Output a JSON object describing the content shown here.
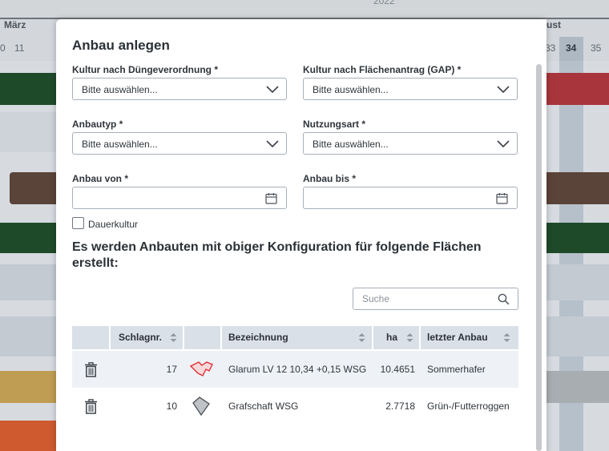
{
  "background": {
    "year_label": "2022",
    "month_left": "März",
    "month_right": "ust",
    "weeks_left": [
      "0",
      "11"
    ],
    "weeks_right": [
      "33",
      "34",
      "35"
    ],
    "highlighted_week": "34",
    "colors": {
      "dark_green": "#1f4a2a",
      "brown": "#5a4338",
      "red": "#a8353b",
      "gold": "#bf9d52",
      "orange": "#cf5a30",
      "grey": "#a8adb2",
      "highlight": "#b6c0cb"
    }
  },
  "modal": {
    "title": "Anbau anlegen",
    "fields": {
      "kultur_dv": {
        "label": "Kultur nach Düngeverordnung *",
        "value": "Bitte auswählen..."
      },
      "kultur_gap": {
        "label": "Kultur nach Flächenantrag (GAP) *",
        "value": "Bitte auswählen..."
      },
      "anbautyp": {
        "label": "Anbautyp *",
        "value": "Bitte auswählen..."
      },
      "nutzungsart": {
        "label": "Nutzungsart *",
        "value": "Bitte auswählen..."
      },
      "anbau_von": {
        "label": "Anbau von *",
        "value": ""
      },
      "anbau_bis": {
        "label": "Anbau bis *",
        "value": ""
      }
    },
    "dauerkultur": {
      "label": "Dauerkultur",
      "checked": false
    },
    "section_title": "Es werden Anbauten mit obiger Konfiguration für folgende Flächen erstellt:",
    "search": {
      "placeholder": "Suche",
      "value": ""
    },
    "table": {
      "columns": [
        "Schlagnr.",
        "Bezeichnung",
        "ha",
        "letzter Anbau"
      ],
      "rows": [
        {
          "schlagnr": "17",
          "bezeichnung": "Glarum LV 12 10,34 +0,15 WSG",
          "ha": "10.4651",
          "letzter_anbau": "Sommerhafer",
          "shape_color": "#e0252b",
          "shape_fill": "#f6d9da"
        },
        {
          "schlagnr": "10",
          "bezeichnung": "Grafschaft WSG",
          "ha": "2.7718",
          "letzter_anbau": "Grün-/Futterroggen",
          "shape_color": "#4a4f55",
          "shape_fill": "#bfc3c7"
        }
      ]
    }
  },
  "icons": {
    "dropdown": "chevron-down-icon",
    "date": "calendar-icon",
    "search": "search-icon",
    "delete": "trash-icon",
    "sort": "sort-icon",
    "field": "field-shape-icon"
  }
}
